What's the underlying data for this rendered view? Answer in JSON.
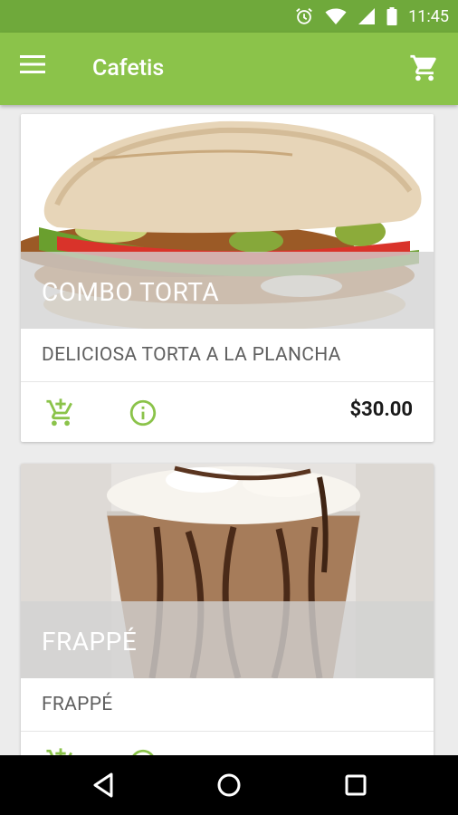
{
  "status_bar": {
    "time": "11:45",
    "icons": [
      "alarm-icon",
      "wifi-icon",
      "signal-icon",
      "battery-icon"
    ]
  },
  "toolbar": {
    "title": "Cafetis",
    "menu_icon": "hamburger-menu-icon",
    "cart_icon": "shopping-cart-icon"
  },
  "products": [
    {
      "name": "COMBO TORTA",
      "description": "DELICIOSA TORTA A LA PLANCHA",
      "price": "$30.00",
      "image": "torta-sandwich-image"
    },
    {
      "name": "FRAPPÉ",
      "description": "FRAPPÉ",
      "price": "",
      "image": "frappe-drink-image"
    }
  ],
  "navigation": {
    "back_icon": "back-triangle-icon",
    "home_icon": "home-circle-icon",
    "recents_icon": "recents-square-icon"
  },
  "colors": {
    "status_bar": "#6fa93b",
    "toolbar": "#8bc34a",
    "accent_icons": "#8bc34a",
    "background": "#ececec"
  }
}
